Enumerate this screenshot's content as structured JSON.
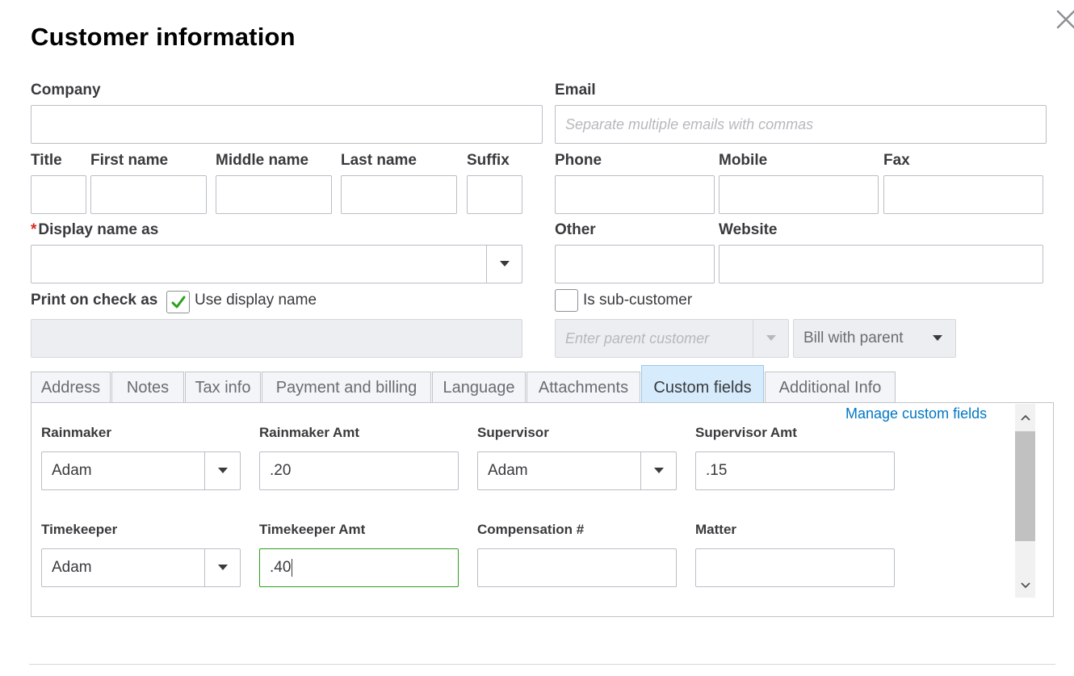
{
  "dialog": {
    "title": "Customer information"
  },
  "labels": {
    "company": "Company",
    "email": "Email",
    "title": "Title",
    "first_name": "First name",
    "middle_name": "Middle name",
    "last_name": "Last name",
    "suffix": "Suffix",
    "phone": "Phone",
    "mobile": "Mobile",
    "fax": "Fax",
    "display_name": "Display name as",
    "other": "Other",
    "website": "Website",
    "print_on_check": "Print on check as",
    "use_display_name": "Use display name",
    "is_sub_customer": "Is sub-customer"
  },
  "fields": {
    "email_placeholder": "Separate multiple emails with commas",
    "parent_customer_placeholder": "Enter parent customer",
    "bill_with_parent": "Bill with parent",
    "use_display_name_checked": true,
    "is_sub_customer_checked": false
  },
  "tabs": [
    {
      "label": "Address"
    },
    {
      "label": "Notes"
    },
    {
      "label": "Tax info"
    },
    {
      "label": "Payment and billing"
    },
    {
      "label": "Language"
    },
    {
      "label": "Attachments"
    },
    {
      "label": "Custom fields",
      "active": true
    },
    {
      "label": "Additional Info"
    }
  ],
  "custom_fields": {
    "manage_link": "Manage custom fields",
    "rainmaker": {
      "label": "Rainmaker",
      "value": "Adam"
    },
    "rainmaker_amt": {
      "label": "Rainmaker Amt",
      "value": ".20"
    },
    "supervisor": {
      "label": "Supervisor",
      "value": "Adam"
    },
    "supervisor_amt": {
      "label": "Supervisor Amt",
      "value": ".15"
    },
    "timekeeper": {
      "label": "Timekeeper",
      "value": "Adam"
    },
    "timekeeper_amt": {
      "label": "Timekeeper Amt",
      "value": ".40"
    },
    "compensation": {
      "label": "Compensation #",
      "value": ""
    },
    "matter": {
      "label": "Matter",
      "value": ""
    }
  },
  "colors": {
    "accent_green": "#2ca01c",
    "link_blue": "#0077c5",
    "required_red": "#d52b1e",
    "active_tab": "#d6ebfc"
  }
}
